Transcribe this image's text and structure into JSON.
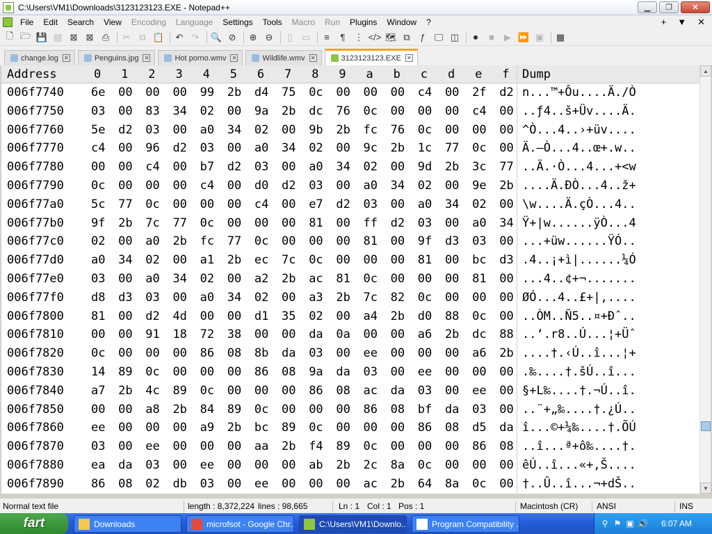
{
  "window": {
    "title": "C:\\Users\\VM1\\Downloads\\3123123123.EXE - Notepad++",
    "minimize_glyph": "▁",
    "maximize_glyph": "❐",
    "close_glyph": "✕"
  },
  "menu": {
    "items": [
      {
        "label": "File",
        "enabled": true
      },
      {
        "label": "Edit",
        "enabled": true
      },
      {
        "label": "Search",
        "enabled": true
      },
      {
        "label": "View",
        "enabled": true
      },
      {
        "label": "Encoding",
        "enabled": false
      },
      {
        "label": "Language",
        "enabled": false
      },
      {
        "label": "Settings",
        "enabled": true
      },
      {
        "label": "Tools",
        "enabled": true
      },
      {
        "label": "Macro",
        "enabled": false
      },
      {
        "label": "Run",
        "enabled": false
      },
      {
        "label": "Plugins",
        "enabled": true
      },
      {
        "label": "Window",
        "enabled": true
      },
      {
        "label": "?",
        "enabled": true
      }
    ],
    "right_plus": "+",
    "right_down": "▼",
    "right_close": "✕"
  },
  "toolbar": {
    "buttons": [
      {
        "name": "new-file-icon",
        "glyph": "🗋",
        "enabled": true
      },
      {
        "name": "open-file-icon",
        "glyph": "🗁",
        "enabled": true
      },
      {
        "name": "save-icon",
        "glyph": "💾",
        "enabled": false
      },
      {
        "name": "save-all-icon",
        "glyph": "▤",
        "enabled": false
      },
      {
        "name": "close-file-icon",
        "glyph": "⊠",
        "enabled": true
      },
      {
        "name": "close-all-icon",
        "glyph": "⊠",
        "enabled": true
      },
      {
        "name": "print-icon",
        "glyph": "⎙",
        "enabled": true
      },
      {
        "name": "sep",
        "glyph": "",
        "enabled": true
      },
      {
        "name": "cut-icon",
        "glyph": "✂",
        "enabled": false
      },
      {
        "name": "copy-icon",
        "glyph": "⧉",
        "enabled": false
      },
      {
        "name": "paste-icon",
        "glyph": "📋",
        "enabled": false
      },
      {
        "name": "sep",
        "glyph": "",
        "enabled": true
      },
      {
        "name": "undo-icon",
        "glyph": "↶",
        "enabled": true
      },
      {
        "name": "redo-icon",
        "glyph": "↷",
        "enabled": false
      },
      {
        "name": "sep",
        "glyph": "",
        "enabled": true
      },
      {
        "name": "find-icon",
        "glyph": "🔍",
        "enabled": true
      },
      {
        "name": "replace-icon",
        "glyph": "⊘",
        "enabled": true
      },
      {
        "name": "sep",
        "glyph": "",
        "enabled": true
      },
      {
        "name": "zoom-in-icon",
        "glyph": "⊕",
        "enabled": true
      },
      {
        "name": "zoom-out-icon",
        "glyph": "⊖",
        "enabled": true
      },
      {
        "name": "sep",
        "glyph": "",
        "enabled": true
      },
      {
        "name": "sync-vertical-icon",
        "glyph": "▯",
        "enabled": false
      },
      {
        "name": "sync-horizontal-icon",
        "glyph": "▭",
        "enabled": false
      },
      {
        "name": "sep",
        "glyph": "",
        "enabled": true
      },
      {
        "name": "word-wrap-icon",
        "glyph": "≡",
        "enabled": true
      },
      {
        "name": "show-all-chars-icon",
        "glyph": "¶",
        "enabled": true
      },
      {
        "name": "indent-guide-icon",
        "glyph": "⋮",
        "enabled": true
      },
      {
        "name": "xml-tags-icon",
        "glyph": "</>",
        "enabled": true
      },
      {
        "name": "document-map-icon",
        "glyph": "🗺",
        "enabled": true
      },
      {
        "name": "document-list-icon",
        "glyph": "⧉",
        "enabled": true
      },
      {
        "name": "function-list-icon",
        "glyph": "ƒ",
        "enabled": true
      },
      {
        "name": "monitor-icon",
        "glyph": "🖵",
        "enabled": true
      },
      {
        "name": "folder-workspace-icon",
        "glyph": "◫",
        "enabled": true
      },
      {
        "name": "sep",
        "glyph": "",
        "enabled": true
      },
      {
        "name": "record-macro-icon",
        "glyph": "⏺",
        "enabled": true
      },
      {
        "name": "stop-record-icon",
        "glyph": "■",
        "enabled": false
      },
      {
        "name": "play-macro-icon",
        "glyph": "▶",
        "enabled": false
      },
      {
        "name": "run-macro-multiple-icon",
        "glyph": "⏩",
        "enabled": true
      },
      {
        "name": "save-macro-icon",
        "glyph": "▣",
        "enabled": false
      },
      {
        "name": "sep",
        "glyph": "",
        "enabled": true
      },
      {
        "name": "hex-editor-icon",
        "glyph": "▦",
        "enabled": true
      }
    ]
  },
  "tabs": [
    {
      "label": "change.log",
      "color": "#9bbce0",
      "active": false
    },
    {
      "label": "Penguins.jpg",
      "color": "#9bbce0",
      "active": false
    },
    {
      "label": "Hot porno.wmv",
      "color": "#9bbce0",
      "active": false
    },
    {
      "label": "Wildlife.wmv",
      "color": "#9bbce0",
      "active": false
    },
    {
      "label": "3123123123.EXE",
      "color": "#8ec63f",
      "active": true
    }
  ],
  "tab_close_glyph": "✕",
  "hex": {
    "header": {
      "address": "Address",
      "cols": [
        "0",
        "1",
        "2",
        "3",
        "4",
        "5",
        "6",
        "7",
        "8",
        "9",
        "a",
        "b",
        "c",
        "d",
        "e",
        "f"
      ],
      "dump": "Dump"
    },
    "rows": [
      {
        "addr": "006f7740",
        "bytes": [
          "6e",
          "00",
          "00",
          "00",
          "99",
          "2b",
          "d4",
          "75",
          "0c",
          "00",
          "00",
          "00",
          "c4",
          "00",
          "2f",
          "d2"
        ],
        "dump": "n...™+Ôu....Ä./Ò"
      },
      {
        "addr": "006f7750",
        "bytes": [
          "03",
          "00",
          "83",
          "34",
          "02",
          "00",
          "9a",
          "2b",
          "dc",
          "76",
          "0c",
          "00",
          "00",
          "00",
          "c4",
          "00"
        ],
        "dump": "..ƒ4..š+Üv....Ä."
      },
      {
        "addr": "006f7760",
        "bytes": [
          "5e",
          "d2",
          "03",
          "00",
          "a0",
          "34",
          "02",
          "00",
          "9b",
          "2b",
          "fc",
          "76",
          "0c",
          "00",
          "00",
          "00"
        ],
        "dump": "^Ò...4..›+üv...."
      },
      {
        "addr": "006f7770",
        "bytes": [
          "c4",
          "00",
          "96",
          "d2",
          "03",
          "00",
          "a0",
          "34",
          "02",
          "00",
          "9c",
          "2b",
          "1c",
          "77",
          "0c",
          "00"
        ],
        "dump": "Ä.–Ò...4..œ+.w.."
      },
      {
        "addr": "006f7780",
        "bytes": [
          "00",
          "00",
          "c4",
          "00",
          "b7",
          "d2",
          "03",
          "00",
          "a0",
          "34",
          "02",
          "00",
          "9d",
          "2b",
          "3c",
          "77"
        ],
        "dump": "..Ä.·Ò...4...+<w"
      },
      {
        "addr": "006f7790",
        "bytes": [
          "0c",
          "00",
          "00",
          "00",
          "c4",
          "00",
          "d0",
          "d2",
          "03",
          "00",
          "a0",
          "34",
          "02",
          "00",
          "9e",
          "2b"
        ],
        "dump": "....Ä.ÐÒ...4..ž+"
      },
      {
        "addr": "006f77a0",
        "bytes": [
          "5c",
          "77",
          "0c",
          "00",
          "00",
          "00",
          "c4",
          "00",
          "e7",
          "d2",
          "03",
          "00",
          "a0",
          "34",
          "02",
          "00"
        ],
        "dump": "\\w....Ä.çÒ...4.."
      },
      {
        "addr": "006f77b0",
        "bytes": [
          "9f",
          "2b",
          "7c",
          "77",
          "0c",
          "00",
          "00",
          "00",
          "81",
          "00",
          "ff",
          "d2",
          "03",
          "00",
          "a0",
          "34"
        ],
        "dump": "Ÿ+|w......ÿÒ...4"
      },
      {
        "addr": "006f77c0",
        "bytes": [
          "02",
          "00",
          "a0",
          "2b",
          "fc",
          "77",
          "0c",
          "00",
          "00",
          "00",
          "81",
          "00",
          "9f",
          "d3",
          "03",
          "00"
        ],
        "dump": "...+üw......ŸÓ.."
      },
      {
        "addr": "006f77d0",
        "bytes": [
          "a0",
          "34",
          "02",
          "00",
          "a1",
          "2b",
          "ec",
          "7c",
          "0c",
          "00",
          "00",
          "00",
          "81",
          "00",
          "bc",
          "d3"
        ],
        "dump": ".4..¡+ì|......¼Ó"
      },
      {
        "addr": "006f77e0",
        "bytes": [
          "03",
          "00",
          "a0",
          "34",
          "02",
          "00",
          "a2",
          "2b",
          "ac",
          "81",
          "0c",
          "00",
          "00",
          "00",
          "81",
          "00"
        ],
        "dump": "...4..¢+¬......."
      },
      {
        "addr": "006f77f0",
        "bytes": [
          "d8",
          "d3",
          "03",
          "00",
          "a0",
          "34",
          "02",
          "00",
          "a3",
          "2b",
          "7c",
          "82",
          "0c",
          "00",
          "00",
          "00"
        ],
        "dump": "ØÓ...4..£+|,...."
      },
      {
        "addr": "006f7800",
        "bytes": [
          "81",
          "00",
          "d2",
          "4d",
          "00",
          "00",
          "d1",
          "35",
          "02",
          "00",
          "a4",
          "2b",
          "d0",
          "88",
          "0c",
          "00"
        ],
        "dump": "..ÒM..Ñ5..¤+Ðˆ.."
      },
      {
        "addr": "006f7810",
        "bytes": [
          "00",
          "00",
          "91",
          "18",
          "72",
          "38",
          "00",
          "00",
          "da",
          "0a",
          "00",
          "00",
          "a6",
          "2b",
          "dc",
          "88"
        ],
        "dump": "..‘.r8..Ú...¦+Üˆ"
      },
      {
        "addr": "006f7820",
        "bytes": [
          "0c",
          "00",
          "00",
          "00",
          "86",
          "08",
          "8b",
          "da",
          "03",
          "00",
          "ee",
          "00",
          "00",
          "00",
          "a6",
          "2b"
        ],
        "dump": "....†.‹Ú..î...¦+"
      },
      {
        "addr": "006f7830",
        "bytes": [
          "14",
          "89",
          "0c",
          "00",
          "00",
          "00",
          "86",
          "08",
          "9a",
          "da",
          "03",
          "00",
          "ee",
          "00",
          "00",
          "00"
        ],
        "dump": ".‰....†.šÚ..î..."
      },
      {
        "addr": "006f7840",
        "bytes": [
          "a7",
          "2b",
          "4c",
          "89",
          "0c",
          "00",
          "00",
          "00",
          "86",
          "08",
          "ac",
          "da",
          "03",
          "00",
          "ee",
          "00"
        ],
        "dump": "§+L‰....†.¬Ú..î."
      },
      {
        "addr": "006f7850",
        "bytes": [
          "00",
          "00",
          "a8",
          "2b",
          "84",
          "89",
          "0c",
          "00",
          "00",
          "00",
          "86",
          "08",
          "bf",
          "da",
          "03",
          "00"
        ],
        "dump": "..¨+„‰....†.¿Ú.."
      },
      {
        "addr": "006f7860",
        "bytes": [
          "ee",
          "00",
          "00",
          "00",
          "a9",
          "2b",
          "bc",
          "89",
          "0c",
          "00",
          "00",
          "00",
          "86",
          "08",
          "d5",
          "da"
        ],
        "dump": "î...©+¼‰....†.ÕÚ"
      },
      {
        "addr": "006f7870",
        "bytes": [
          "03",
          "00",
          "ee",
          "00",
          "00",
          "00",
          "aa",
          "2b",
          "f4",
          "89",
          "0c",
          "00",
          "00",
          "00",
          "86",
          "08"
        ],
        "dump": "..î...ª+ô‰....†."
      },
      {
        "addr": "006f7880",
        "bytes": [
          "ea",
          "da",
          "03",
          "00",
          "ee",
          "00",
          "00",
          "00",
          "ab",
          "2b",
          "2c",
          "8a",
          "0c",
          "00",
          "00",
          "00"
        ],
        "dump": "êÚ..î...«+,Š...."
      },
      {
        "addr": "006f7890",
        "bytes": [
          "86",
          "08",
          "02",
          "db",
          "03",
          "00",
          "ee",
          "00",
          "00",
          "00",
          "ac",
          "2b",
          "64",
          "8a",
          "0c",
          "00"
        ],
        "dump": "†..Û..î...¬+dŠ.."
      }
    ]
  },
  "scrollbar": {
    "up_glyph": "▲",
    "down_glyph": "▼"
  },
  "status": {
    "type": "Normal text file",
    "length": "length : 8,372,224",
    "lines": "lines : 98,665",
    "ln": "Ln : 1",
    "col": "Col : 1",
    "pos": "Pos : 1",
    "eol": "Macintosh (CR)",
    "encoding": "ANSI",
    "mode": "INS"
  },
  "taskbar": {
    "start_label": "fart",
    "items": [
      {
        "label": "Downloads",
        "icon_color": "#f2c94c",
        "active": false
      },
      {
        "label": "microfsot - Google Chr...",
        "icon_color": "#e04b3c",
        "active": false
      },
      {
        "label": "C:\\Users\\VM1\\Downlo...",
        "icon_color": "#8ec63f",
        "active": true
      },
      {
        "label": "Program Compatibility ...",
        "icon_color": "#ffffff",
        "active": false
      }
    ],
    "tray_icons": [
      "⚲",
      "⚑",
      "▣",
      "🔊"
    ],
    "clock": "6:07 AM"
  }
}
